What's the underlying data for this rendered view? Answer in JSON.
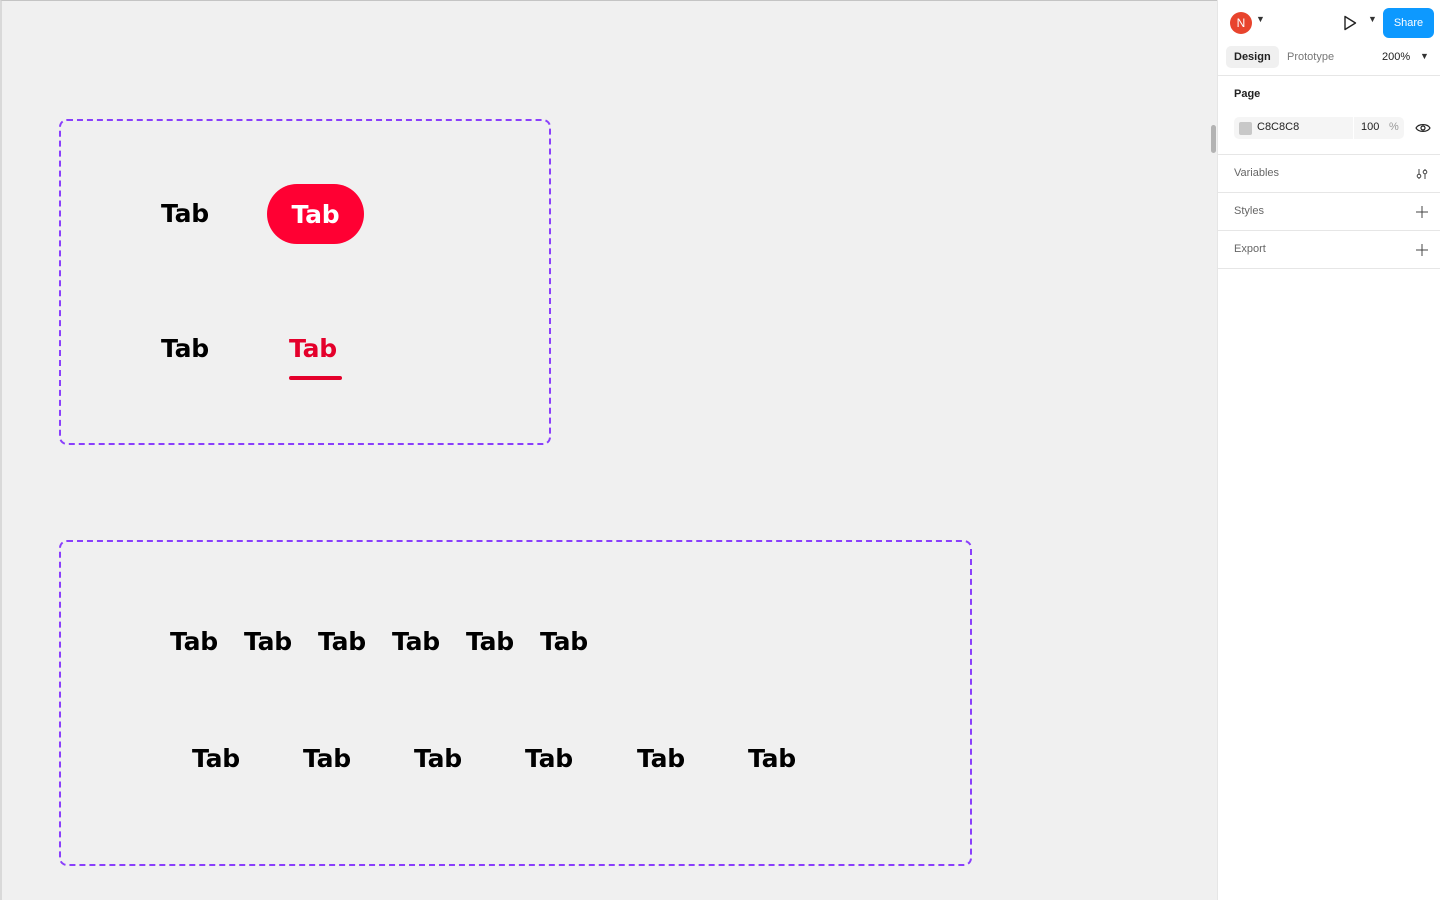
{
  "canvas": {
    "frame_a": {
      "row1": {
        "plain_tab": "Tab",
        "pill_tab": "Tab"
      },
      "row2": {
        "plain_tab": "Tab",
        "underlined_tab": "Tab"
      }
    },
    "frame_b": {
      "row1": [
        "Tab",
        "Tab",
        "Tab",
        "Tab",
        "Tab",
        "Tab"
      ],
      "row2": [
        "Tab",
        "Tab",
        "Tab",
        "Tab",
        "Tab",
        "Tab"
      ]
    },
    "colors": {
      "active_pill": "#ff0033",
      "active_underline": "#e4002b",
      "frame_border": "#8a3ffc"
    }
  },
  "panel": {
    "avatar_initial": "N",
    "share_label": "Share",
    "tabs": {
      "design": "Design",
      "prototype": "Prototype"
    },
    "zoom": "200%",
    "page": {
      "title": "Page",
      "color_hex": "C8C8C8",
      "opacity": "100",
      "opacity_unit": "%"
    },
    "variables_label": "Variables",
    "styles_label": "Styles",
    "export_label": "Export",
    "accent": "#0d99ff"
  }
}
